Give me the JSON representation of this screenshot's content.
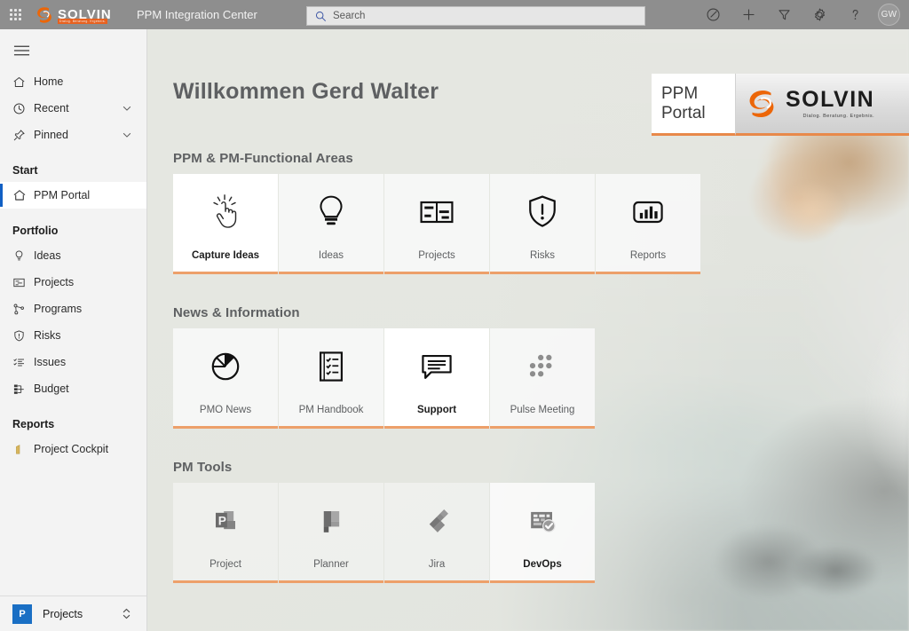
{
  "header": {
    "app_launcher_icon": "waffle-grid-icon",
    "brand_name": "SOLVIN",
    "brand_tagline": "Dialog. Beratung. Ergebnis.",
    "app_title": "PPM Integration Center",
    "search": {
      "placeholder": "Search",
      "value": "",
      "icon": "search-icon"
    },
    "icons": [
      {
        "name": "edit-pencil-circle-icon",
        "label": "Edit"
      },
      {
        "name": "plus-icon",
        "label": "New"
      },
      {
        "name": "filter-icon",
        "label": "Filter"
      },
      {
        "name": "gear-icon",
        "label": "Settings"
      },
      {
        "name": "question-mark-icon",
        "label": "Help"
      }
    ],
    "avatar_initials": "GW"
  },
  "sidebar": {
    "hamburger_icon": "hamburger-menu-icon",
    "top_items": [
      {
        "label": "Home",
        "icon": "home-icon",
        "chevron": false
      },
      {
        "label": "Recent",
        "icon": "clock-icon",
        "chevron": true
      },
      {
        "label": "Pinned",
        "icon": "pin-icon",
        "chevron": true
      }
    ],
    "groups": [
      {
        "title": "Start",
        "items": [
          {
            "label": "PPM Portal",
            "icon": "home-outline-icon",
            "selected": true
          }
        ]
      },
      {
        "title": "Portfolio",
        "items": [
          {
            "label": "Ideas",
            "icon": "lightbulb-icon",
            "selected": false
          },
          {
            "label": "Projects",
            "icon": "projects-grid-icon",
            "selected": false
          },
          {
            "label": "Programs",
            "icon": "programs-network-icon",
            "selected": false
          },
          {
            "label": "Risks",
            "icon": "shield-alert-icon",
            "selected": false
          },
          {
            "label": "Issues",
            "icon": "checklist-icon",
            "selected": false
          },
          {
            "label": "Budget",
            "icon": "budget-icon",
            "selected": false
          }
        ]
      },
      {
        "title": "Reports",
        "items": [
          {
            "label": "Project Cockpit",
            "icon": "report-bar-icon",
            "selected": false
          }
        ]
      }
    ],
    "footer": {
      "badge": "P",
      "label": "Projects",
      "chevron_icon": "chevron-updown-icon"
    }
  },
  "main": {
    "welcome_title": "Willkommen Gerd Walter",
    "portal_badge": {
      "line1": "PPM",
      "line2": "Portal"
    },
    "sections": [
      {
        "title": "PPM & PM-Functional Areas",
        "tiles": [
          {
            "label": "Capture Ideas",
            "icon": "click-hand-icon",
            "hovered": true,
            "glass": false
          },
          {
            "label": "Ideas",
            "icon": "lightbulb-icon",
            "hovered": false,
            "glass": false
          },
          {
            "label": "Projects",
            "icon": "gantt-board-icon",
            "hovered": false,
            "glass": false
          },
          {
            "label": "Risks",
            "icon": "shield-alert-icon",
            "hovered": false,
            "glass": false
          },
          {
            "label": "Reports",
            "icon": "powerbi-chart-icon",
            "hovered": false,
            "glass": false
          }
        ]
      },
      {
        "title": "News & Information",
        "tiles": [
          {
            "label": "PMO News",
            "icon": "pie-chart-icon",
            "hovered": false,
            "glass": false
          },
          {
            "label": "PM Handbook",
            "icon": "checklist-doc-icon",
            "hovered": false,
            "glass": false
          },
          {
            "label": "Support",
            "icon": "speech-bubble-icon",
            "hovered": true,
            "glass": false
          },
          {
            "label": "Pulse Meeting",
            "icon": "dot-grid-icon",
            "hovered": false,
            "glass": false
          }
        ]
      },
      {
        "title": "PM Tools",
        "tiles": [
          {
            "label": "Project",
            "icon": "ms-project-icon",
            "hovered": false,
            "glass": true
          },
          {
            "label": "Planner",
            "icon": "ms-planner-icon",
            "hovered": false,
            "glass": true
          },
          {
            "label": "Jira",
            "icon": "jira-icon",
            "hovered": false,
            "glass": true
          },
          {
            "label": "DevOps",
            "icon": "azure-devops-icon",
            "hovered": true,
            "glass": true
          }
        ]
      }
    ]
  },
  "colors": {
    "accent_orange": "#e8894a",
    "tile_underline": "#eda06a",
    "selection_blue": "#1160c4",
    "header_gray": "#8e8e8e",
    "brand_orange": "#ec6608"
  }
}
